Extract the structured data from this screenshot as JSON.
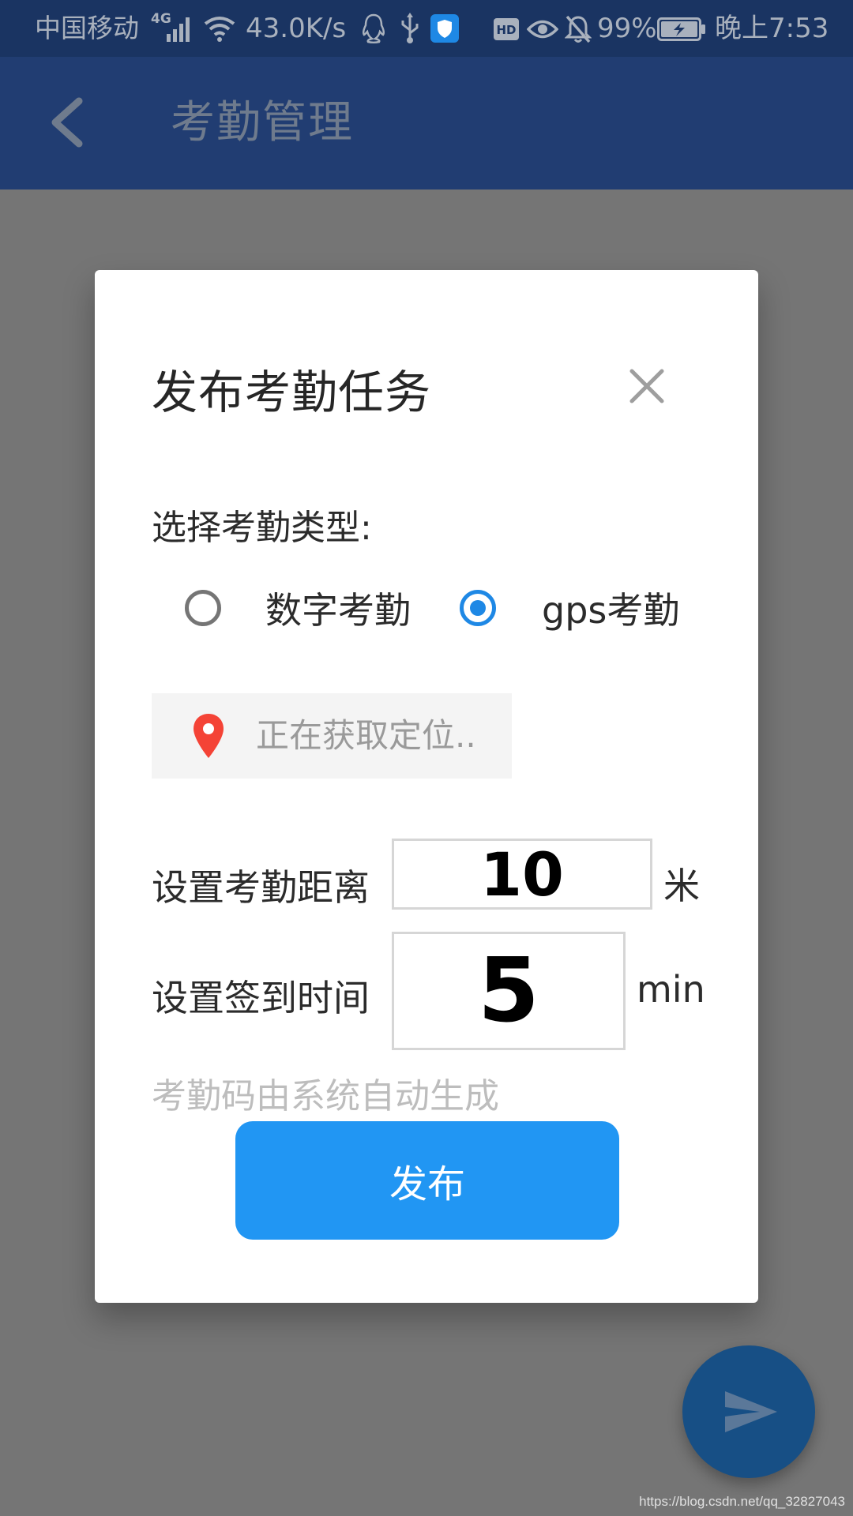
{
  "status_bar": {
    "carrier": "中国移动",
    "network_generation": "4G",
    "net_speed": "43.0K/s",
    "battery_percent": "99%",
    "time": "晚上7:53",
    "icons": [
      "signal-icon",
      "wifi-icon",
      "qq-icon",
      "usb-icon",
      "shield-icon",
      "hd-icon",
      "eye-icon",
      "bell-off-icon",
      "battery-charging-icon"
    ]
  },
  "app_bar": {
    "title": "考勤管理",
    "back_icon": "chevron-left-icon"
  },
  "dialog": {
    "title": "发布考勤任务",
    "close_icon": "close-icon",
    "type_label": "选择考勤类型:",
    "options": [
      {
        "label": "数字考勤",
        "checked": false
      },
      {
        "label": "gps考勤",
        "checked": true
      }
    ],
    "location": {
      "icon": "map-pin-icon",
      "text": "正在获取定位.."
    },
    "distance": {
      "label": "设置考勤距离",
      "value": "10",
      "unit": "米"
    },
    "checkin_time": {
      "label": "设置签到时间",
      "value": "5",
      "unit": "min"
    },
    "hint": "考勤码由系统自动生成",
    "publish_label": "发布"
  },
  "fab": {
    "icon": "send-icon"
  },
  "watermark": "https://blog.csdn.net/qq_32827043",
  "colors": {
    "status_bar": "#1a3462",
    "app_bar": "#213d72",
    "overlay": "#757575",
    "accent": "#2196f3",
    "radio_checked": "#1e88e5",
    "pin": "#f44336",
    "fab": "#174f85"
  }
}
